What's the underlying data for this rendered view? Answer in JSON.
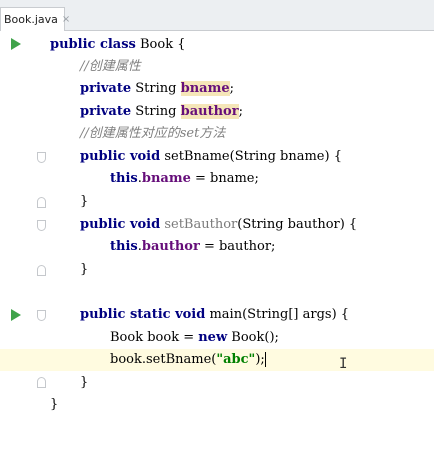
{
  "tab": {
    "filename": "Book.java",
    "close_glyph": "×"
  },
  "lines": {
    "l1": {
      "kw": "public class",
      "name": " Book {"
    },
    "l2": {
      "comment": "//创建属性"
    },
    "l3": {
      "kw": "private",
      "type": " String ",
      "field": "bname",
      "end": ";"
    },
    "l4": {
      "kw": "private",
      "type": " String ",
      "field": "bauthor",
      "end": ";"
    },
    "l5": {
      "comment": "//创建属性对应的set方法"
    },
    "l6": {
      "kw": "public void",
      "method": " setBname",
      "params": "(String bname) {"
    },
    "l7": {
      "kw": "this",
      "dot": ".",
      "field": "bname",
      "rest": " = bname;"
    },
    "l8": {
      "text": "}"
    },
    "l9": {
      "kw": "public void",
      "method": " setBauthor",
      "params": "(String bauthor) {"
    },
    "l10": {
      "kw": "this",
      "dot": ".",
      "field": "bauthor",
      "rest": " = bauthor;"
    },
    "l11": {
      "text": "}"
    },
    "l13": {
      "kw": "public static void",
      "rest": " main(String[] args) {"
    },
    "l14": {
      "pre": "Book book = ",
      "kw": "new",
      "post": " Book();"
    },
    "l15": {
      "pre": "book.setBname(",
      "str": "\"abc\"",
      "post": ");"
    },
    "l16": {
      "text": "}"
    },
    "l17": {
      "text": "}"
    }
  },
  "icons": {
    "run": "run-icon",
    "fold": "fold-icon",
    "cursor": "text-cursor-icon"
  }
}
